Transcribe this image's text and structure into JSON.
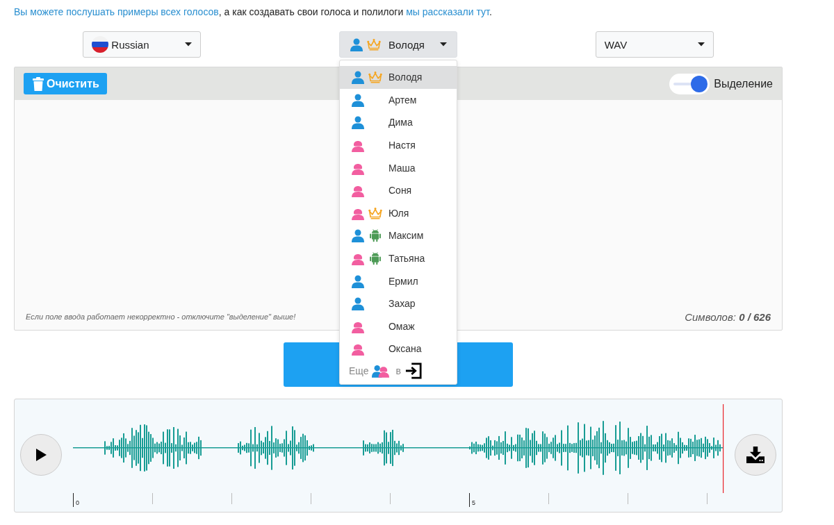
{
  "intro": {
    "link_1": "Вы можете послушать примеры всех голосов",
    "middle": ", а как создавать свои голоса и полилоги ",
    "link_2": "мы рассказали тут",
    "end": "."
  },
  "language_select": {
    "value": "Russian"
  },
  "voice_select": {
    "value": "Володя",
    "kind": "male",
    "premium": true,
    "android": false,
    "expanded": true
  },
  "format_select": {
    "value": "WAV"
  },
  "voices": [
    {
      "name": "Володя",
      "kind": "male",
      "premium": true,
      "android": false,
      "selected": true
    },
    {
      "name": "Артем",
      "kind": "male",
      "premium": false,
      "android": false,
      "selected": false
    },
    {
      "name": "Дима",
      "kind": "male",
      "premium": false,
      "android": false,
      "selected": false
    },
    {
      "name": "Настя",
      "kind": "female",
      "premium": false,
      "android": false,
      "selected": false
    },
    {
      "name": "Маша",
      "kind": "female",
      "premium": false,
      "android": false,
      "selected": false
    },
    {
      "name": "Соня",
      "kind": "female",
      "premium": false,
      "android": false,
      "selected": false
    },
    {
      "name": "Юля",
      "kind": "female",
      "premium": true,
      "android": false,
      "selected": false
    },
    {
      "name": "Максим",
      "kind": "male",
      "premium": false,
      "android": true,
      "selected": false
    },
    {
      "name": "Татьяна",
      "kind": "female",
      "premium": false,
      "android": true,
      "selected": false
    },
    {
      "name": "Ермил",
      "kind": "male",
      "premium": false,
      "android": false,
      "selected": false
    },
    {
      "name": "Захар",
      "kind": "male",
      "premium": false,
      "android": false,
      "selected": false
    },
    {
      "name": "Омаж",
      "kind": "female",
      "premium": false,
      "android": false,
      "selected": false
    },
    {
      "name": "Оксана",
      "kind": "female",
      "premium": false,
      "android": false,
      "selected": false
    }
  ],
  "voices_more": {
    "prefix": "Еще",
    "middle": "в"
  },
  "editor": {
    "clear_button": "Очистить",
    "highlight_toggle": {
      "label": "Выделение",
      "on": true
    },
    "hint": "Если поле ввода работает некорректно - отключите \"выделение\" выше!",
    "counter": "Символов: **0 / 626**"
  },
  "player": {
    "timeline_labels": [
      "0",
      "5"
    ]
  }
}
